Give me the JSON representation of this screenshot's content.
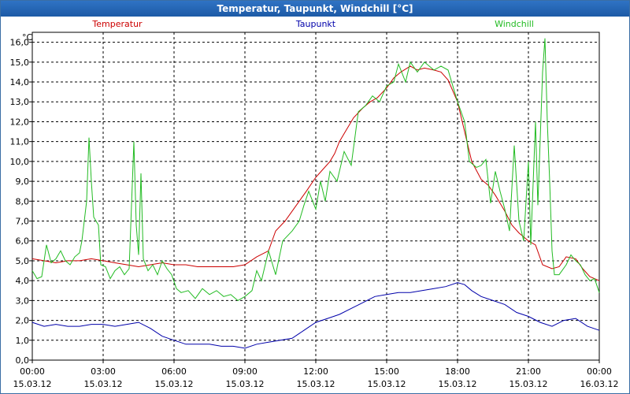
{
  "window": {
    "title": "Temperatur, Taupunkt, Windchill [°C]"
  },
  "chart_data": {
    "type": "line",
    "title": "Temperatur, Taupunkt, Windchill [°C]",
    "ylabel": "°C",
    "ylim": [
      0,
      16.5
    ],
    "xlim": [
      0,
      24
    ],
    "grid": true,
    "legend_position": "top",
    "yticks": [
      "0,0",
      "1,0",
      "2,0",
      "3,0",
      "4,0",
      "5,0",
      "6,0",
      "7,0",
      "8,0",
      "9,0",
      "10,0",
      "11,0",
      "12,0",
      "13,0",
      "14,0",
      "15,0",
      "16,0"
    ],
    "xticks": [
      {
        "time": "00:00",
        "date": "15.03.12"
      },
      {
        "time": "03:00",
        "date": "15.03.12"
      },
      {
        "time": "06:00",
        "date": "15.03.12"
      },
      {
        "time": "09:00",
        "date": "15.03.12"
      },
      {
        "time": "12:00",
        "date": "15.03.12"
      },
      {
        "time": "15:00",
        "date": "15.03.12"
      },
      {
        "time": "18:00",
        "date": "15.03.12"
      },
      {
        "time": "21:00",
        "date": "15.03.12"
      },
      {
        "time": "00:00",
        "date": "16.03.12"
      }
    ],
    "series": [
      {
        "name": "Temperatur",
        "color": "#cc0000",
        "points": [
          [
            0,
            5.1
          ],
          [
            0.5,
            5.0
          ],
          [
            1,
            4.9
          ],
          [
            1.5,
            5.0
          ],
          [
            2,
            5.0
          ],
          [
            2.5,
            5.1
          ],
          [
            3,
            5.0
          ],
          [
            3.5,
            4.9
          ],
          [
            4,
            4.8
          ],
          [
            4.5,
            4.7
          ],
          [
            5,
            4.8
          ],
          [
            5.5,
            4.9
          ],
          [
            6,
            4.8
          ],
          [
            6.5,
            4.8
          ],
          [
            7,
            4.7
          ],
          [
            7.5,
            4.7
          ],
          [
            8,
            4.7
          ],
          [
            8.5,
            4.7
          ],
          [
            9,
            4.8
          ],
          [
            9.5,
            5.2
          ],
          [
            10,
            5.5
          ],
          [
            10.3,
            6.5
          ],
          [
            10.7,
            7.0
          ],
          [
            11,
            7.5
          ],
          [
            11.3,
            8.0
          ],
          [
            11.6,
            8.5
          ],
          [
            12,
            9.2
          ],
          [
            12.3,
            9.6
          ],
          [
            12.6,
            10.0
          ],
          [
            12.8,
            10.4
          ],
          [
            13,
            11.0
          ],
          [
            13.3,
            11.6
          ],
          [
            13.6,
            12.2
          ],
          [
            14,
            12.7
          ],
          [
            14.3,
            13.0
          ],
          [
            14.6,
            13.2
          ],
          [
            15,
            13.7
          ],
          [
            15.3,
            14.2
          ],
          [
            15.6,
            14.5
          ],
          [
            16,
            14.8
          ],
          [
            16.3,
            14.6
          ],
          [
            16.6,
            14.7
          ],
          [
            17,
            14.6
          ],
          [
            17.3,
            14.5
          ],
          [
            17.6,
            14.1
          ],
          [
            18,
            13.0
          ],
          [
            18.3,
            11.5
          ],
          [
            18.6,
            10.0
          ],
          [
            19,
            9.1
          ],
          [
            19.3,
            8.8
          ],
          [
            19.6,
            8.3
          ],
          [
            20,
            7.5
          ],
          [
            20.3,
            6.8
          ],
          [
            20.6,
            6.4
          ],
          [
            21,
            6.0
          ],
          [
            21.3,
            5.8
          ],
          [
            21.6,
            4.8
          ],
          [
            22,
            4.6
          ],
          [
            22.3,
            4.7
          ],
          [
            22.6,
            5.2
          ],
          [
            23,
            5.1
          ],
          [
            23.3,
            4.6
          ],
          [
            23.6,
            4.2
          ],
          [
            24,
            4.0
          ]
        ]
      },
      {
        "name": "Taupunkt",
        "color": "#0000aa",
        "points": [
          [
            0,
            1.9
          ],
          [
            0.5,
            1.7
          ],
          [
            1,
            1.8
          ],
          [
            1.5,
            1.7
          ],
          [
            2,
            1.7
          ],
          [
            2.5,
            1.8
          ],
          [
            3,
            1.8
          ],
          [
            3.5,
            1.7
          ],
          [
            4,
            1.8
          ],
          [
            4.5,
            1.9
          ],
          [
            5,
            1.6
          ],
          [
            5.5,
            1.2
          ],
          [
            6,
            1.0
          ],
          [
            6.5,
            0.8
          ],
          [
            7,
            0.8
          ],
          [
            7.5,
            0.8
          ],
          [
            8,
            0.7
          ],
          [
            8.5,
            0.7
          ],
          [
            9,
            0.6
          ],
          [
            9.5,
            0.8
          ],
          [
            10,
            0.9
          ],
          [
            10.5,
            1.0
          ],
          [
            11,
            1.1
          ],
          [
            11.5,
            1.5
          ],
          [
            12,
            1.9
          ],
          [
            12.5,
            2.1
          ],
          [
            13,
            2.3
          ],
          [
            13.5,
            2.6
          ],
          [
            14,
            2.9
          ],
          [
            14.5,
            3.2
          ],
          [
            15,
            3.3
          ],
          [
            15.5,
            3.4
          ],
          [
            16,
            3.4
          ],
          [
            16.5,
            3.5
          ],
          [
            17,
            3.6
          ],
          [
            17.5,
            3.7
          ],
          [
            18,
            3.9
          ],
          [
            18.3,
            3.8
          ],
          [
            18.6,
            3.5
          ],
          [
            19,
            3.2
          ],
          [
            19.5,
            3.0
          ],
          [
            20,
            2.8
          ],
          [
            20.5,
            2.4
          ],
          [
            21,
            2.2
          ],
          [
            21.5,
            1.9
          ],
          [
            22,
            1.7
          ],
          [
            22.5,
            2.0
          ],
          [
            23,
            2.1
          ],
          [
            23.5,
            1.7
          ],
          [
            24,
            1.5
          ]
        ]
      },
      {
        "name": "Windchill",
        "color": "#22bb22",
        "points": [
          [
            0,
            4.5
          ],
          [
            0.2,
            4.1
          ],
          [
            0.4,
            4.2
          ],
          [
            0.6,
            5.8
          ],
          [
            0.8,
            4.9
          ],
          [
            1,
            5.1
          ],
          [
            1.2,
            5.5
          ],
          [
            1.4,
            5.0
          ],
          [
            1.6,
            4.8
          ],
          [
            1.8,
            5.2
          ],
          [
            2,
            5.4
          ],
          [
            2.1,
            6.0
          ],
          [
            2.3,
            8.0
          ],
          [
            2.4,
            11.2
          ],
          [
            2.5,
            9.0
          ],
          [
            2.6,
            7.2
          ],
          [
            2.8,
            6.8
          ],
          [
            2.9,
            4.8
          ],
          [
            3.1,
            4.7
          ],
          [
            3.3,
            4.1
          ],
          [
            3.5,
            4.5
          ],
          [
            3.7,
            4.7
          ],
          [
            3.9,
            4.3
          ],
          [
            4.1,
            4.6
          ],
          [
            4.3,
            11.0
          ],
          [
            4.4,
            6.8
          ],
          [
            4.5,
            5.3
          ],
          [
            4.6,
            9.4
          ],
          [
            4.7,
            5.1
          ],
          [
            4.9,
            4.5
          ],
          [
            5.1,
            4.8
          ],
          [
            5.3,
            4.3
          ],
          [
            5.5,
            5.0
          ],
          [
            5.7,
            4.6
          ],
          [
            5.9,
            4.3
          ],
          [
            6.1,
            3.6
          ],
          [
            6.3,
            3.4
          ],
          [
            6.6,
            3.5
          ],
          [
            6.9,
            3.1
          ],
          [
            7.2,
            3.6
          ],
          [
            7.5,
            3.3
          ],
          [
            7.8,
            3.5
          ],
          [
            8.1,
            3.2
          ],
          [
            8.4,
            3.3
          ],
          [
            8.7,
            3.0
          ],
          [
            9,
            3.2
          ],
          [
            9.3,
            3.5
          ],
          [
            9.5,
            4.5
          ],
          [
            9.7,
            4.0
          ],
          [
            10,
            5.5
          ],
          [
            10.3,
            4.3
          ],
          [
            10.6,
            6.0
          ],
          [
            11,
            6.5
          ],
          [
            11.3,
            7.0
          ],
          [
            11.5,
            7.8
          ],
          [
            11.7,
            8.5
          ],
          [
            12,
            7.6
          ],
          [
            12.2,
            9.0
          ],
          [
            12.4,
            8.0
          ],
          [
            12.6,
            9.5
          ],
          [
            12.9,
            9.0
          ],
          [
            13.2,
            10.5
          ],
          [
            13.5,
            9.8
          ],
          [
            13.8,
            12.5
          ],
          [
            14.1,
            12.8
          ],
          [
            14.4,
            13.3
          ],
          [
            14.7,
            13.0
          ],
          [
            15,
            13.8
          ],
          [
            15.3,
            14.0
          ],
          [
            15.5,
            14.9
          ],
          [
            15.8,
            14.0
          ],
          [
            16,
            15.0
          ],
          [
            16.3,
            14.5
          ],
          [
            16.6,
            15.0
          ],
          [
            17,
            14.6
          ],
          [
            17.3,
            14.8
          ],
          [
            17.6,
            14.6
          ],
          [
            18,
            13.0
          ],
          [
            18.3,
            12.0
          ],
          [
            18.5,
            10.0
          ],
          [
            18.8,
            9.7
          ],
          [
            19,
            9.8
          ],
          [
            19.2,
            10.1
          ],
          [
            19.4,
            7.9
          ],
          [
            19.6,
            9.5
          ],
          [
            19.8,
            8.5
          ],
          [
            20,
            7.6
          ],
          [
            20.2,
            6.5
          ],
          [
            20.4,
            10.8
          ],
          [
            20.6,
            7.0
          ],
          [
            20.8,
            6.0
          ],
          [
            21,
            10.0
          ],
          [
            21.1,
            5.8
          ],
          [
            21.3,
            12.0
          ],
          [
            21.4,
            7.8
          ],
          [
            21.6,
            14.5
          ],
          [
            21.7,
            16.2
          ],
          [
            21.8,
            12.0
          ],
          [
            21.9,
            9.0
          ],
          [
            22,
            5.5
          ],
          [
            22.1,
            4.3
          ],
          [
            22.3,
            4.3
          ],
          [
            22.6,
            4.8
          ],
          [
            22.8,
            5.3
          ],
          [
            23,
            5.0
          ],
          [
            23.2,
            4.8
          ],
          [
            23.4,
            4.3
          ],
          [
            23.6,
            4.0
          ],
          [
            23.8,
            4.1
          ],
          [
            24,
            3.4
          ]
        ]
      }
    ]
  }
}
